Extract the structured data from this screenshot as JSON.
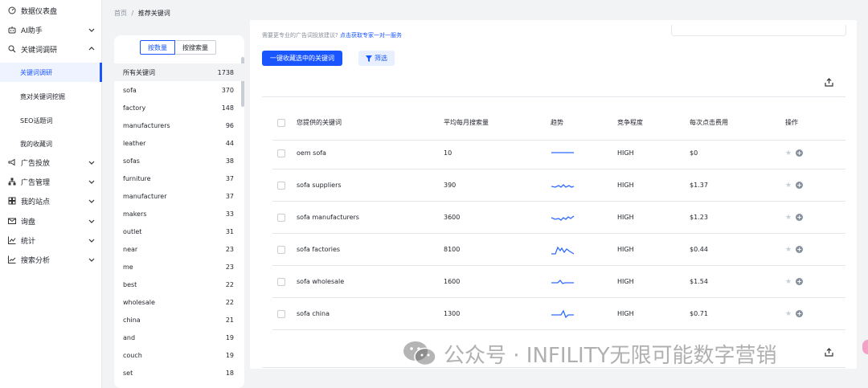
{
  "sidebar": {
    "items": [
      {
        "label": "数据仪表盘",
        "icon": "dashboard-icon",
        "chevron": ""
      },
      {
        "label": "AI助手",
        "icon": "robot-icon",
        "chevron": "down"
      },
      {
        "label": "关键词调研",
        "icon": "search-icon",
        "chevron": "up"
      },
      {
        "label": "广告投放",
        "icon": "megaphone-icon",
        "chevron": "down"
      },
      {
        "label": "广告管理",
        "icon": "hierarchy-icon",
        "chevron": "down"
      },
      {
        "label": "我的站点",
        "icon": "grid-icon",
        "chevron": "down"
      },
      {
        "label": "询盘",
        "icon": "mail-icon",
        "chevron": "down"
      },
      {
        "label": "统计",
        "icon": "chart-icon",
        "chevron": "down"
      },
      {
        "label": "搜索分析",
        "icon": "analysis-icon",
        "chevron": "down"
      }
    ],
    "sub_items": [
      {
        "label": "关键词调研",
        "active": true
      },
      {
        "label": "竟对关键词挖掘",
        "active": false
      },
      {
        "label": "SEO话题词",
        "active": false
      },
      {
        "label": "我的收藏词",
        "active": false
      }
    ]
  },
  "breadcrumb": {
    "home": "首页",
    "sep": "/",
    "current": "推荐关键词"
  },
  "keyword_panel": {
    "toggle_by_count": "按数量",
    "toggle_by_volume": "按搜索量",
    "rows": [
      {
        "word": "所有关键词",
        "count": "1738"
      },
      {
        "word": "sofa",
        "count": "370"
      },
      {
        "word": "factory",
        "count": "148"
      },
      {
        "word": "manufacturers",
        "count": "96"
      },
      {
        "word": "leather",
        "count": "44"
      },
      {
        "word": "sofas",
        "count": "38"
      },
      {
        "word": "furniture",
        "count": "37"
      },
      {
        "word": "manufacturer",
        "count": "37"
      },
      {
        "word": "makers",
        "count": "33"
      },
      {
        "word": "outlet",
        "count": "31"
      },
      {
        "word": "near",
        "count": "23"
      },
      {
        "word": "me",
        "count": "23"
      },
      {
        "word": "best",
        "count": "22"
      },
      {
        "word": "wholesale",
        "count": "22"
      },
      {
        "word": "china",
        "count": "21"
      },
      {
        "word": "and",
        "count": "19"
      },
      {
        "word": "couch",
        "count": "19"
      },
      {
        "word": "set",
        "count": "18"
      }
    ]
  },
  "main": {
    "hint_text": "需要更专业的广告词投放建议?",
    "hint_link": "点击获取专家一对一服务",
    "top_faded": "",
    "collect_button": "一键收藏选中的关键词",
    "filter_button": "筛选",
    "table": {
      "headers": {
        "keyword": "您提供的关键词",
        "volume": "平均每月搜索量",
        "trend": "趋势",
        "competition": "竞争程度",
        "cpc": "每次点击费用",
        "action": "操作"
      },
      "rows": [
        {
          "keyword": "oem sofa",
          "volume": "10",
          "competition": "HIGH",
          "cpc": "$0",
          "trend": "flat"
        },
        {
          "keyword": "sofa suppliers",
          "volume": "390",
          "competition": "HIGH",
          "cpc": "$1.37",
          "trend": "wave"
        },
        {
          "keyword": "sofa manufacturers",
          "volume": "3600",
          "competition": "HIGH",
          "cpc": "$1.23",
          "trend": "wave2"
        },
        {
          "keyword": "sofa factories",
          "volume": "8100",
          "competition": "HIGH",
          "cpc": "$0.44",
          "trend": "spiky"
        },
        {
          "keyword": "sofa wholesale",
          "volume": "1600",
          "competition": "HIGH",
          "cpc": "$1.54",
          "trend": "blip"
        },
        {
          "keyword": "sofa china",
          "volume": "1300",
          "competition": "HIGH",
          "cpc": "$0.71",
          "trend": "blip2"
        }
      ]
    }
  },
  "watermark": {
    "text": "公众号 · INFILITY无限可能数字营销"
  },
  "colors": {
    "accent": "#1a56ff",
    "trend_line": "#2f6bff"
  }
}
